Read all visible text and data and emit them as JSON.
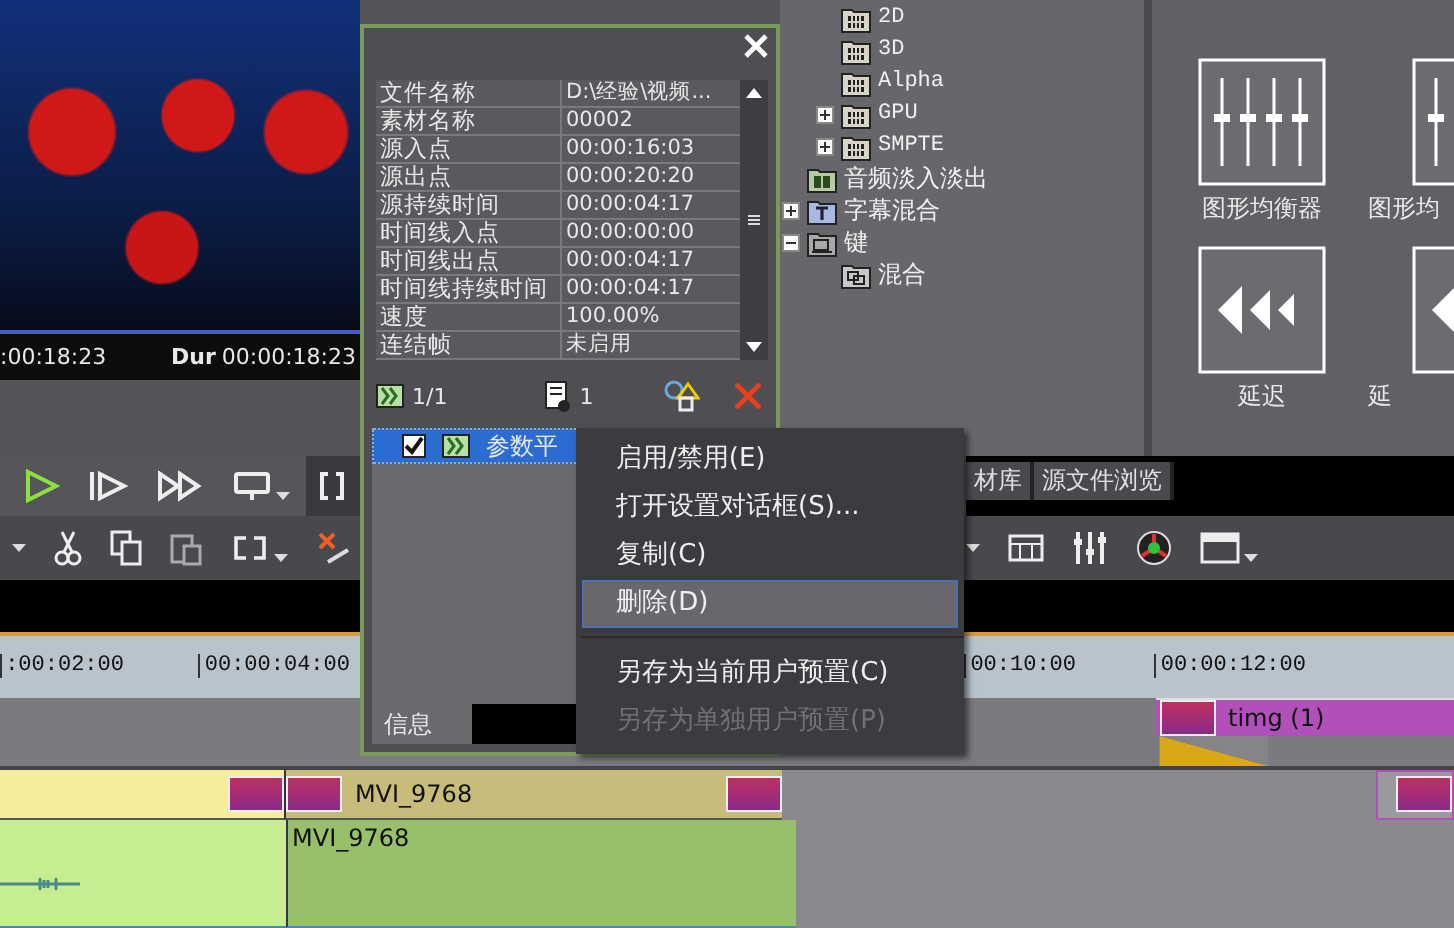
{
  "preview": {
    "timecode": ":00:18:23",
    "duration_label": "Dur",
    "duration": "00:00:18:23"
  },
  "tree": {
    "items": [
      {
        "children": [
          {
            "label": "2D",
            "kind": "video"
          },
          {
            "label": "3D",
            "kind": "video"
          },
          {
            "label": "Alpha",
            "kind": "video"
          },
          {
            "label": "GPU",
            "kind": "video",
            "expanded": false
          },
          {
            "label": "SMPTE",
            "kind": "video",
            "expanded": false
          }
        ]
      },
      {
        "label": "音频淡入淡出",
        "kind": "audio"
      },
      {
        "label": "字幕混合",
        "kind": "title",
        "expanded": false
      },
      {
        "label": "键",
        "kind": "key",
        "expanded": true,
        "children": [
          {
            "label": "混合",
            "kind": "blend"
          }
        ]
      }
    ]
  },
  "effects": {
    "items": [
      {
        "label": "图形均衡器",
        "kind": "equalizer"
      },
      {
        "label": "图形均",
        "kind": "equalizer"
      },
      {
        "label": "延迟",
        "kind": "delay"
      },
      {
        "label": "延",
        "kind": "delay"
      }
    ]
  },
  "bin_tabs": [
    {
      "label": "材库"
    },
    {
      "label": "源文件浏览"
    }
  ],
  "timeline": {
    "ruler": [
      ":00:02:00",
      "00:00:04:00",
      "00:10:00",
      "00:00:12:00"
    ],
    "tracks": [
      {
        "kind": "title",
        "clips": [
          {
            "kind": "title",
            "label": "timg (1)"
          }
        ]
      },
      {
        "kind": "video",
        "clips": [
          {
            "kind": "video"
          },
          {
            "kind": "video",
            "label": "MVI_9768"
          },
          {
            "kind": "video"
          }
        ]
      },
      {
        "kind": "audio",
        "clips": [
          {
            "kind": "audio"
          },
          {
            "kind": "audio",
            "label": "MVI_9768"
          }
        ]
      }
    ]
  },
  "info_dialog": {
    "properties": [
      {
        "name": "文件名称",
        "value": "D:\\经验\\视频..."
      },
      {
        "name": "素材名称",
        "value": "00002"
      },
      {
        "name": "源入点",
        "value": "00:00:16:03"
      },
      {
        "name": "源出点",
        "value": "00:00:20:20"
      },
      {
        "name": "源持续时间",
        "value": "00:00:04:17"
      },
      {
        "name": "时间线入点",
        "value": "00:00:00:00"
      },
      {
        "name": "时间线出点",
        "value": "00:00:04:17"
      },
      {
        "name": "时间线持续时间",
        "value": "00:00:04:17"
      },
      {
        "name": "速度",
        "value": "100.00%"
      },
      {
        "name": "连结帧",
        "value": "未启用"
      }
    ],
    "clip_counter": "1/1",
    "filter_count": "1",
    "filters": [
      {
        "label": "参数平",
        "enabled": true,
        "selected": true
      }
    ],
    "tabs": [
      {
        "label": "信息",
        "selected": true
      }
    ]
  },
  "context_menu": {
    "items": [
      {
        "kind": "item",
        "label": "启用/禁用(E)",
        "highlighted": false,
        "disabled": false
      },
      {
        "kind": "item",
        "label": "打开设置对话框(S)...",
        "highlighted": false,
        "disabled": false
      },
      {
        "kind": "item",
        "label": "复制(C)",
        "highlighted": false,
        "disabled": false
      },
      {
        "kind": "item",
        "label": "删除(D)",
        "highlighted": true,
        "disabled": false
      },
      {
        "kind": "separator"
      },
      {
        "kind": "item",
        "label": "另存为当前用户预置(C)",
        "highlighted": false,
        "disabled": false
      },
      {
        "kind": "item",
        "label": "另存为单独用户预置(P)",
        "highlighted": false,
        "disabled": true
      }
    ]
  }
}
